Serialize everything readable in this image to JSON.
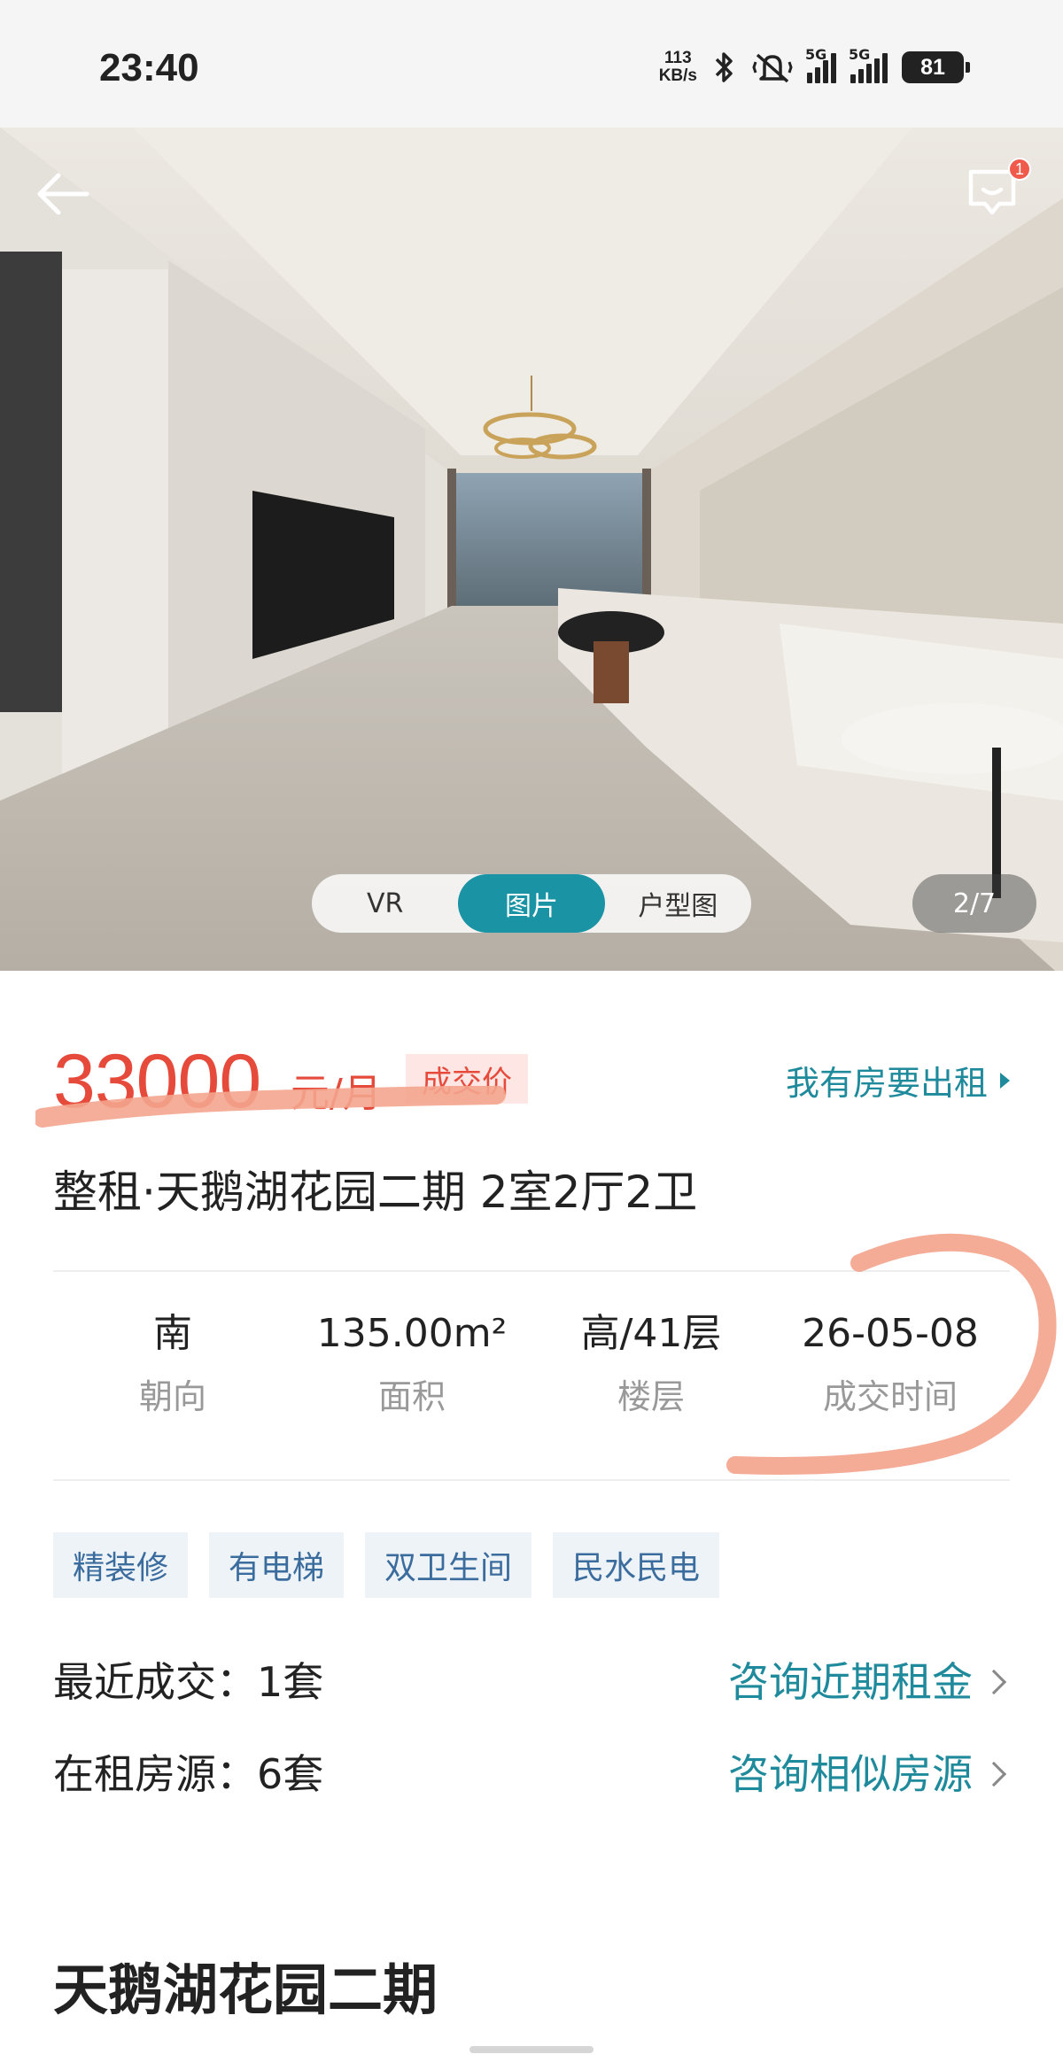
{
  "status_bar": {
    "time": "23:40",
    "net_speed_value": "113",
    "net_speed_unit": "KB/s",
    "sim1_label": "5G",
    "sim2_label": "5G",
    "battery": "81",
    "icons": [
      "bluetooth-icon",
      "mute-vibrate-icon",
      "signal-icon",
      "battery-icon"
    ]
  },
  "gallery": {
    "tabs": [
      {
        "label": "VR",
        "active": false
      },
      {
        "label": "图片",
        "active": true
      },
      {
        "label": "户型图",
        "active": false
      }
    ],
    "counter": "2/7",
    "message_badge": "1"
  },
  "price": {
    "amount": "33000",
    "unit": "元/月",
    "tag": "成交价",
    "rent_link": "我有房要出租"
  },
  "listing": {
    "title": "整租·天鹅湖花园二期 2室2厅2卫"
  },
  "stats": [
    {
      "value": "南",
      "label": "朝向"
    },
    {
      "value": "135.00m²",
      "label": "面积"
    },
    {
      "value": "高/41层",
      "label": "楼层"
    },
    {
      "value": "26-05-08",
      "label": "成交时间"
    }
  ],
  "tags": [
    "精装修",
    "有电梯",
    "双卫生间",
    "民水民电"
  ],
  "info": {
    "recent_deals_label": "最近成交：1套",
    "recent_deals_action": "咨询近期租金",
    "for_rent_label": "在租房源：6套",
    "for_rent_action": "咨询相似房源"
  },
  "community": {
    "title": "天鹅湖花园二期"
  },
  "colors": {
    "price_red": "#e64a3b",
    "accent_teal": "#1a93a5",
    "annotation_orange": "#f4a58e",
    "tag_blue": "#3b6c9e"
  }
}
